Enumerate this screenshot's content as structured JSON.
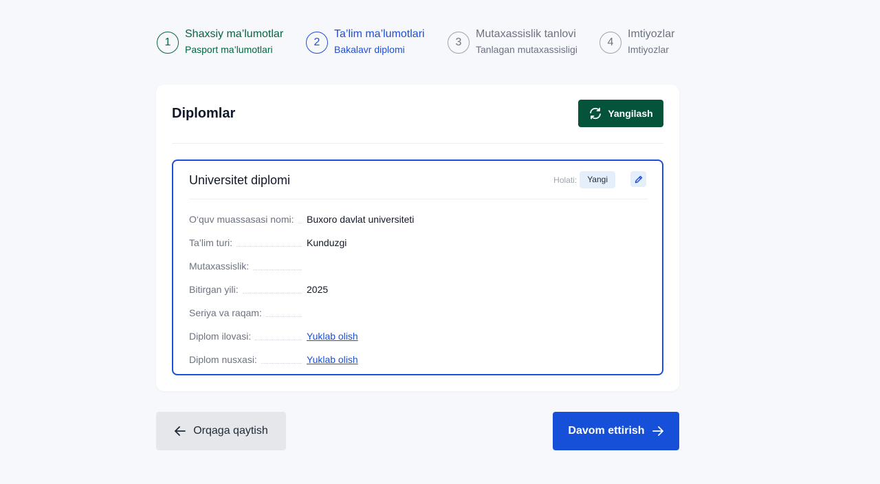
{
  "stepper": {
    "steps": [
      {
        "number": "1",
        "title": "Shaxsiy ma’lumotlar",
        "subtitle": "Pasport ma’lumotlari",
        "state": "done"
      },
      {
        "number": "2",
        "title": "Ta’lim ma’lumotlari",
        "subtitle": "Bakalavr diplomi",
        "state": "active"
      },
      {
        "number": "3",
        "title": "Mutaxassislik tanlovi",
        "subtitle": "Tanlagan mutaxassisligi",
        "state": "todo"
      },
      {
        "number": "4",
        "title": "Imtiyozlar",
        "subtitle": "Imtiyozlar",
        "state": "todo"
      }
    ]
  },
  "card": {
    "title": "Diplomlar",
    "refresh_label": "Yangilash",
    "diploma": {
      "title": "Universitet diplomi",
      "status_label": "Holati:",
      "status_value": "Yangi",
      "fields": [
        {
          "label": "O‘quv muassasasi nomi:",
          "value": "Buxoro davlat universiteti",
          "link": false
        },
        {
          "label": "Ta’lim turi:",
          "value": "Kunduzgi",
          "link": false
        },
        {
          "label": "Mutaxassislik:",
          "value": "",
          "link": false
        },
        {
          "label": "Bitirgan yili:",
          "value": "2025",
          "link": false
        },
        {
          "label": "Seriya va raqam:",
          "value": "",
          "link": false
        },
        {
          "label": "Diplom ilovasi:",
          "value": "Yuklab olish",
          "link": true
        },
        {
          "label": "Diplom nusxasi:",
          "value": "Yuklab olish",
          "link": true
        }
      ]
    }
  },
  "footer": {
    "back_label": "Orqaga qaytish",
    "next_label": "Davom ettirish"
  },
  "colors": {
    "brand_green": "#04533a",
    "accent_blue": "#1d4ed8",
    "primary_button": "#1650d8"
  },
  "icons": {
    "refresh": "refresh-icon",
    "edit": "pencil-icon",
    "back": "arrow-left-icon",
    "next": "arrow-right-icon"
  }
}
